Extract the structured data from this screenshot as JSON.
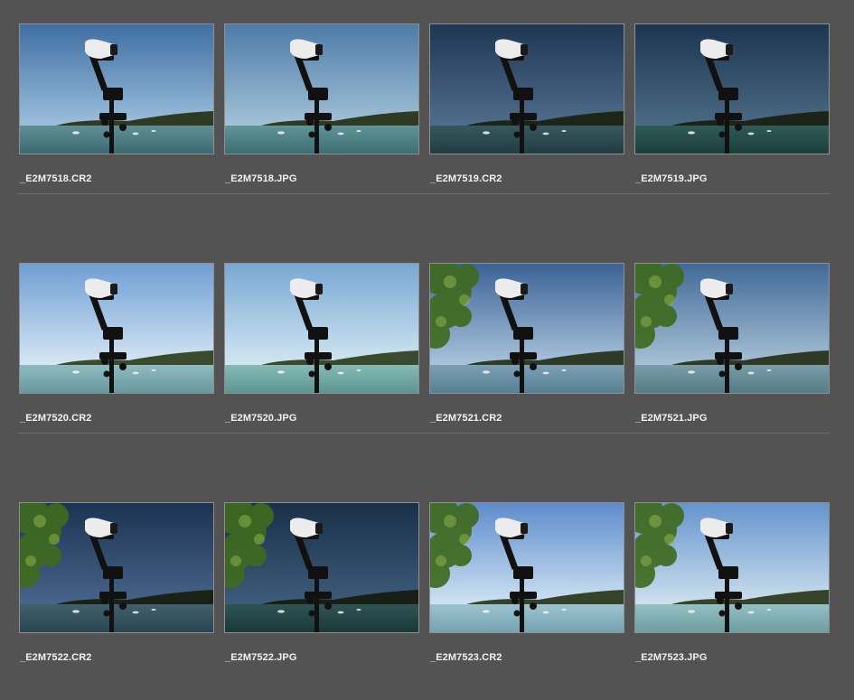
{
  "browser": {
    "items": [
      {
        "filename": "_E2M7518.CR2",
        "sky_top": "#3f6ea3",
        "sky_bottom": "#9cc0dc",
        "water": "#5f8f94",
        "water_dark": "#3d6a70",
        "shore": "#2f3a25",
        "tree": false,
        "selected": false
      },
      {
        "filename": "_E2M7518.JPG",
        "sky_top": "#4d7ba8",
        "sky_bottom": "#a2c2d6",
        "water": "#5f9596",
        "water_dark": "#3e6e71",
        "shore": "#2f3a25",
        "tree": false,
        "selected": false
      },
      {
        "filename": "_E2M7519.CR2",
        "sky_top": "#203653",
        "sky_bottom": "#4f6d8c",
        "water": "#36575d",
        "water_dark": "#223d42",
        "shore": "#1d2518",
        "tree": false,
        "selected": false
      },
      {
        "filename": "_E2M7519.JPG",
        "sky_top": "#1d3550",
        "sky_bottom": "#4a6a84",
        "water": "#2f5a57",
        "water_dark": "#1c3e3c",
        "shore": "#1b2417",
        "tree": false,
        "selected": false
      },
      {
        "filename": "_E2M7520.CR2",
        "sky_top": "#6f9ed3",
        "sky_bottom": "#d6e7f4",
        "water": "#8fbbc0",
        "water_dark": "#66989d",
        "shore": "#3a4a2c",
        "tree": false,
        "selected": false
      },
      {
        "filename": "_E2M7520.JPG",
        "sky_top": "#79a8d4",
        "sky_bottom": "#d2e6f1",
        "water": "#87bab6",
        "water_dark": "#5d9592",
        "shore": "#3a4a2c",
        "tree": false,
        "selected": false
      },
      {
        "filename": "_E2M7521.CR2",
        "sky_top": "#3c6396",
        "sky_bottom": "#a9c3db",
        "water": "#7c9fb4",
        "water_dark": "#587f95",
        "shore": "#2e3a26",
        "tree": true,
        "selected": false
      },
      {
        "filename": "_E2M7521.JPG",
        "sky_top": "#416a98",
        "sky_bottom": "#a6c1d5",
        "water": "#799eaa",
        "water_dark": "#567b87",
        "shore": "#2e3a26",
        "tree": true,
        "selected": false
      },
      {
        "filename": "_E2M7522.CR2",
        "sky_top": "#1d3352",
        "sky_bottom": "#47648a",
        "water": "#41606c",
        "water_dark": "#2a4550",
        "shore": "#1a2216",
        "tree": true,
        "selected": false
      },
      {
        "filename": "_E2M7522.JPG",
        "sky_top": "#1a3049",
        "sky_bottom": "#3d5c7a",
        "water": "#2e5454",
        "water_dark": "#1c3838",
        "shore": "#182015",
        "tree": true,
        "selected": false
      },
      {
        "filename": "_E2M7523.CR2",
        "sky_top": "#5d8ccb",
        "sky_bottom": "#cfe2f3",
        "water": "#9cc3d0",
        "water_dark": "#76a2b1",
        "shore": "#34432a",
        "tree": true,
        "selected": false
      },
      {
        "filename": "_E2M7523.JPG",
        "sky_top": "#6594cd",
        "sky_bottom": "#cde0ee",
        "water": "#93c0c3",
        "water_dark": "#6e9da1",
        "shore": "#34432a",
        "tree": true,
        "selected": false
      }
    ]
  }
}
